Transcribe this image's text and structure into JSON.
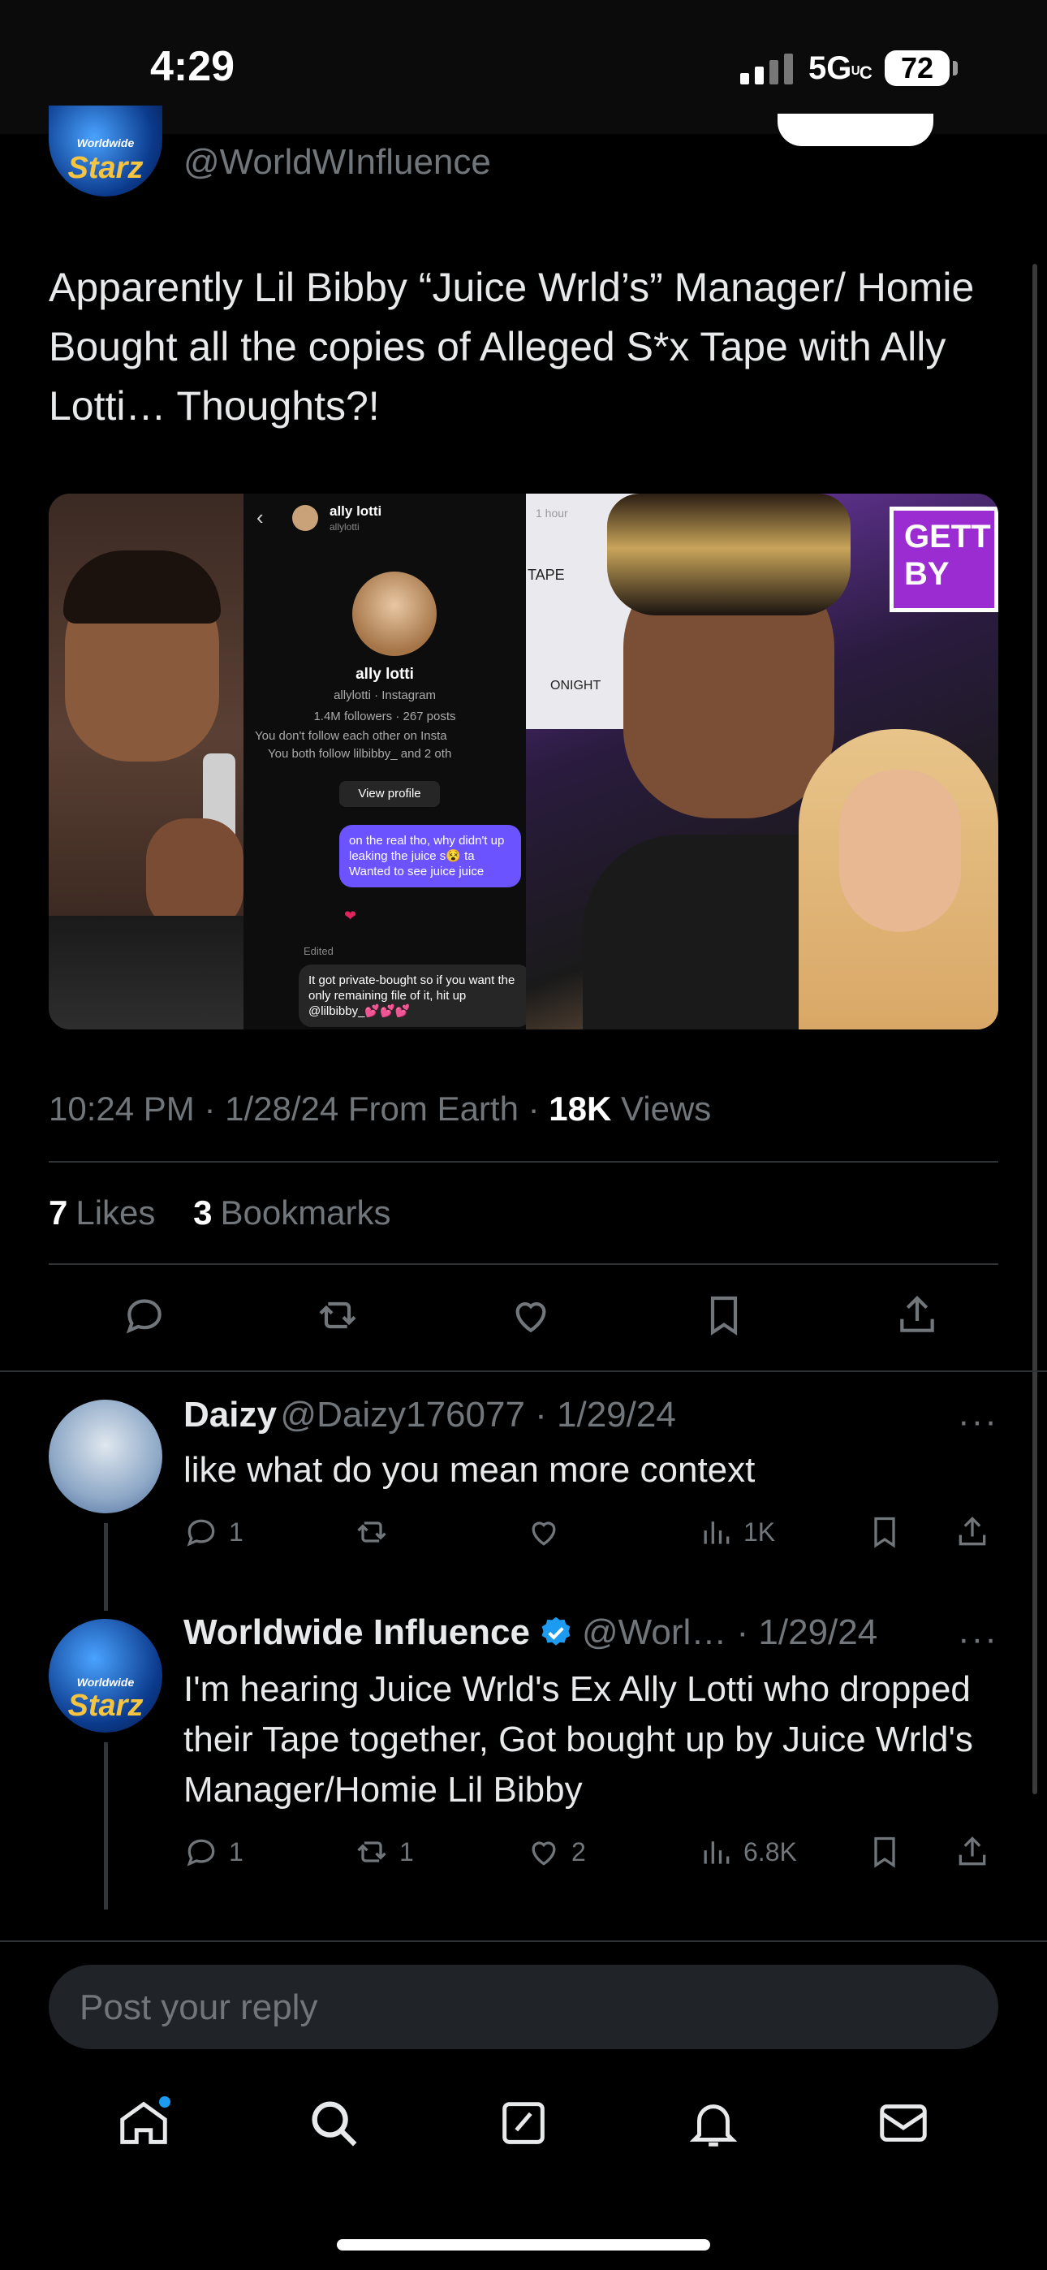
{
  "status_bar": {
    "time": "4:29",
    "network": "5G",
    "battery": "72"
  },
  "author": {
    "avatar_text_top": "Worldwide",
    "avatar_text_main": "Starz",
    "handle": "@WorldWInfluence"
  },
  "tweet": {
    "text": "Apparently Lil Bibby “Juice Wrld’s” Manager/ Homie Bought all the copies of Alleged S*x Tape with Ally Lotti… Thoughts?!",
    "meta": {
      "time_date": "10:24 PM · 1/28/24 From Earth · ",
      "views_count": "18K",
      "views_label": " Views"
    },
    "stats": {
      "likes_count": "7",
      "likes_label": "Likes",
      "bookmarks_count": "3",
      "bookmarks_label": "Bookmarks"
    }
  },
  "media": {
    "dm_name": "ally lotti",
    "dm_handle": "allylotti",
    "profile_name": "ally lotti",
    "profile_sub": "allylotti · Instagram",
    "profile_stats": "1.4M followers · 267 posts",
    "profile_note1": "You don't follow each other on Insta",
    "profile_note2": "You both follow lilbibby_ and 2 oth",
    "view_profile": "View profile",
    "msg1": "on the real tho, why didn't up leaking the juice s😵 ta Wanted to see juice juice",
    "edited": "Edited",
    "msg2": "It got private-bought so if you want the only remaining file of it, hit up @lilbibby_💕💕💕",
    "thumb_label": "1 hour",
    "overlay_tape": "TAPE",
    "overlay_night": "ONIGHT",
    "banner": "GETT BY"
  },
  "replies": [
    {
      "name": "Daizy",
      "handle_date": "@Daizy176077 · 1/29/24",
      "text": "like what do you mean more context",
      "counts": {
        "reply": "1",
        "retweet": "",
        "like": "",
        "views": "1K"
      }
    },
    {
      "name": "Worldwide Influence",
      "handle_date": "@Worl… · 1/29/24",
      "text": "I'm hearing Juice Wrld's Ex Ally Lotti who dropped their Tape together, Got bought up by Juice Wrld's Manager/Homie Lil Bibby",
      "counts": {
        "reply": "1",
        "retweet": "1",
        "like": "2",
        "views": "6.8K"
      }
    }
  ],
  "composer": {
    "placeholder": "Post your reply"
  },
  "icons": [
    "reply-icon",
    "retweet-icon",
    "like-icon",
    "bookmark-icon",
    "share-icon",
    "views-icon",
    "home-icon",
    "search-icon",
    "compose-icon",
    "notifications-icon",
    "messages-icon",
    "verified-icon",
    "more-icon"
  ],
  "colors": {
    "accent": "#1d9bf0",
    "muted": "#71767b",
    "text": "#e7e9ea",
    "background": "#000000"
  }
}
